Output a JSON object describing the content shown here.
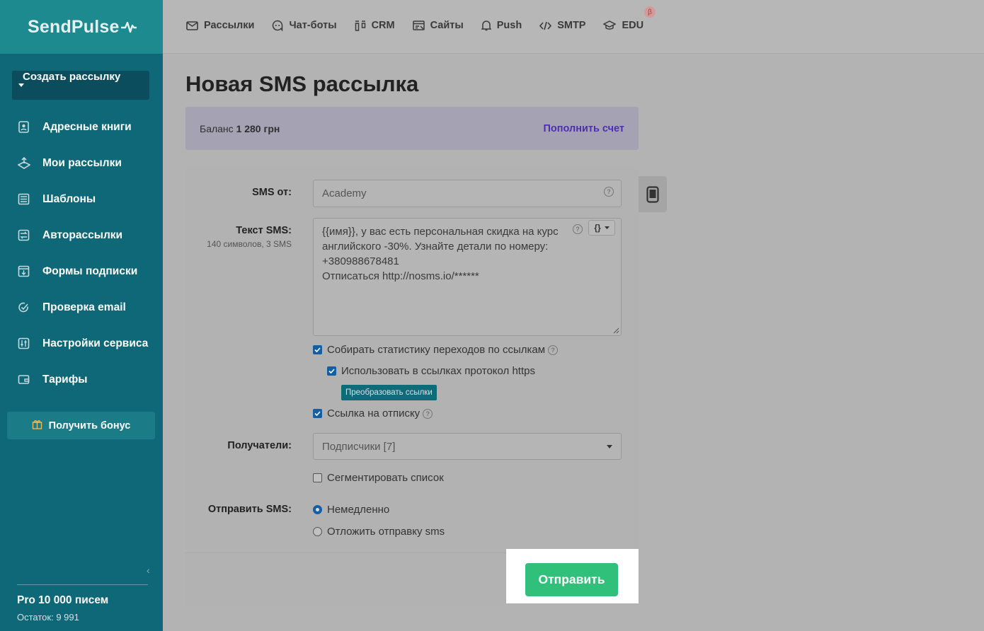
{
  "brand": {
    "name": "SendPulse"
  },
  "sidebar": {
    "create_label": "Создать рассылку",
    "items": [
      {
        "label": "Адресные книги",
        "icon": "address-book-icon"
      },
      {
        "label": "Мои рассылки",
        "icon": "campaigns-icon"
      },
      {
        "label": "Шаблоны",
        "icon": "templates-icon"
      },
      {
        "label": "Авторассылки",
        "icon": "automation-icon"
      },
      {
        "label": "Формы подписки",
        "icon": "subscription-form-icon"
      },
      {
        "label": "Проверка email",
        "icon": "email-check-icon"
      },
      {
        "label": "Настройки сервиса",
        "icon": "settings-sliders-icon"
      },
      {
        "label": "Тарифы",
        "icon": "wallet-icon"
      }
    ],
    "bonus_label": "Получить бонус",
    "plan_name": "Pro 10 000 писем",
    "plan_remaining": "Остаток: 9 991"
  },
  "topnav": {
    "items": [
      {
        "label": "Рассылки",
        "icon": "envelope-icon"
      },
      {
        "label": "Чат-боты",
        "icon": "chat-bot-icon"
      },
      {
        "label": "CRM",
        "icon": "crm-icon"
      },
      {
        "label": "Сайты",
        "icon": "sites-icon"
      },
      {
        "label": "Push",
        "icon": "bell-icon"
      },
      {
        "label": "SMTP",
        "icon": "code-icon"
      },
      {
        "label": "EDU",
        "icon": "graduation-cap-icon"
      }
    ],
    "beta_badge": "β"
  },
  "page": {
    "title": "Новая SMS рассылка",
    "balance_label": "Баланс",
    "balance_value": "1 280 грн",
    "topup_link": "Пополнить счет"
  },
  "form": {
    "sender_label": "SMS от:",
    "sender_value": "Academy",
    "text_label": "Текст SMS:",
    "text_stats": "140 символов, 3 SMS",
    "text_value": "{{имя}}, у вас есть персональная скидка на курс английского -30%. Узнайте детали по номеру: +380988678481\nОтписаться http://nosms.io/******",
    "variables_button": "{}",
    "track_links_label": "Собирать статистику переходов по ссылкам",
    "track_links_checked": true,
    "https_label": "Использовать в ссылках протокол https",
    "https_checked": true,
    "convert_links_button": "Преобразовать ссылки",
    "unsubscribe_label": "Ссылка на отписку",
    "unsubscribe_checked": true,
    "recipients_label": "Получатели:",
    "recipients_value": "Подписчики [7]",
    "segment_label": "Сегментировать список",
    "segment_checked": false,
    "send_label": "Отправить SMS:",
    "send_now_label": "Немедленно",
    "send_later_label": "Отложить отправку sms",
    "send_mode": "now",
    "submit_label": "Отправить"
  },
  "colors": {
    "sidebar_bg": "#0f6877",
    "submit_bg": "#31c07a",
    "link": "#4d2fb0",
    "overlay": "#b3b3b3"
  }
}
